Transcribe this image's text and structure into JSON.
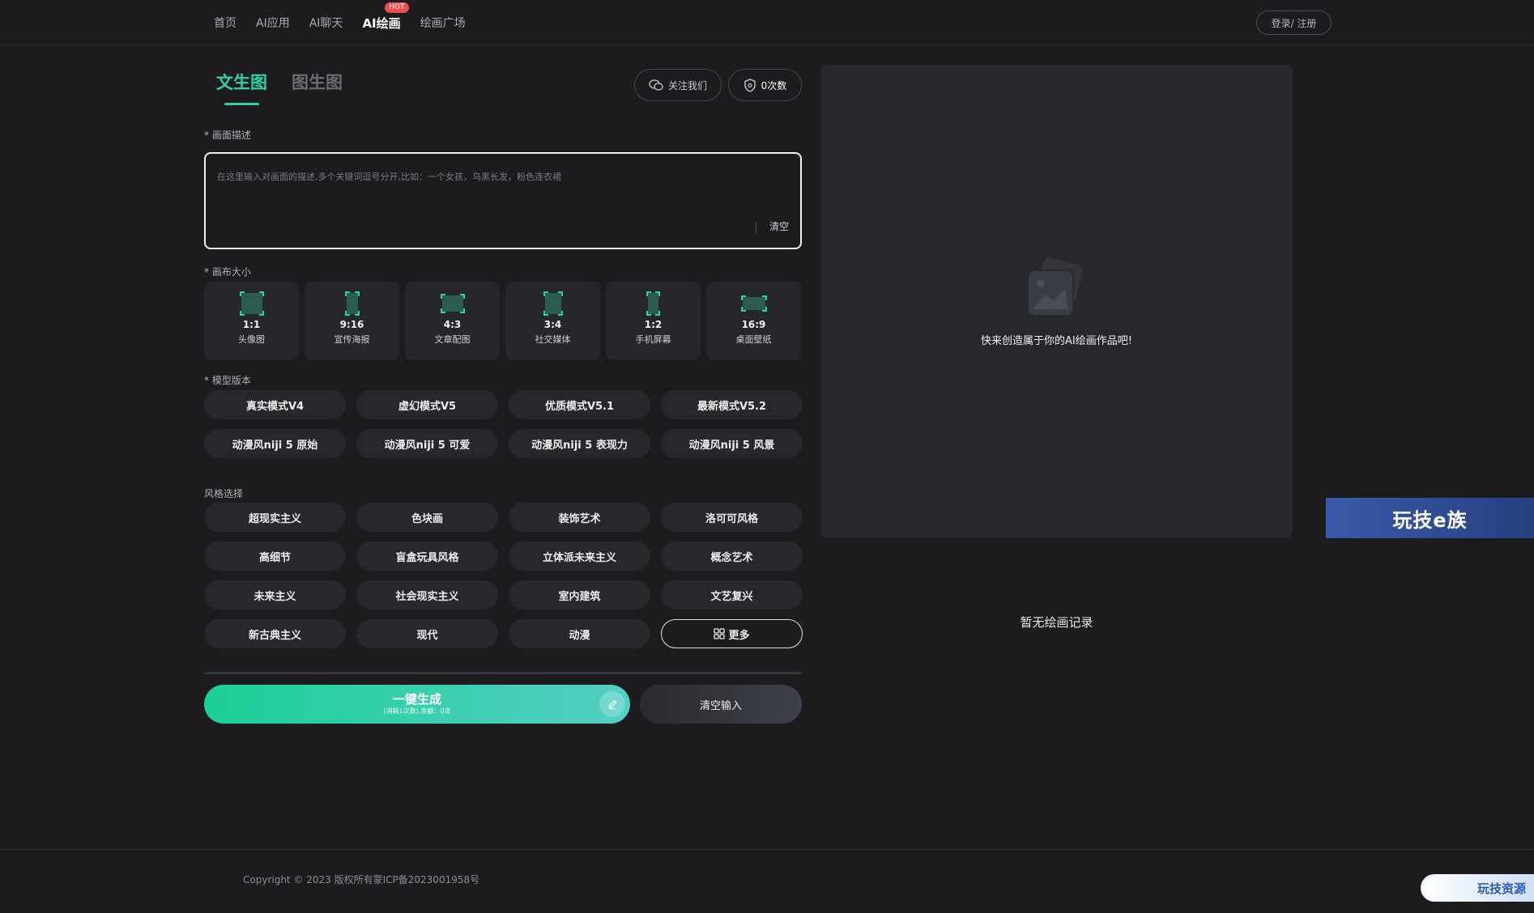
{
  "nav": {
    "items": [
      {
        "label": "首页"
      },
      {
        "label": "AI应用"
      },
      {
        "label": "AI聊天"
      },
      {
        "label": "AI绘画",
        "badge": "HOT"
      },
      {
        "label": "绘画广场"
      }
    ],
    "login": "登录/ 注册"
  },
  "tabs": [
    "文生图",
    "图生图"
  ],
  "actions": {
    "follow": "关注我们",
    "count": "0次数"
  },
  "prompt": {
    "label": "* 画面描述",
    "placeholder": "在这里输入对画面的描述,多个关键词逗号分开,比如：一个女孩，乌黑长发，粉色连衣裙",
    "clear": "清空"
  },
  "canvas": {
    "label": "* 画布大小",
    "options": [
      {
        "ratio": "1:1",
        "name": "头像图"
      },
      {
        "ratio": "9:16",
        "name": "宣传海报"
      },
      {
        "ratio": "4:3",
        "name": "文章配图"
      },
      {
        "ratio": "3:4",
        "name": "社交媒体"
      },
      {
        "ratio": "1:2",
        "name": "手机屏幕"
      },
      {
        "ratio": "16:9",
        "name": "桌面壁纸"
      }
    ]
  },
  "model": {
    "label": "* 模型版本",
    "options": [
      "真实模式V4",
      "虚幻模式V5",
      "优质模式V5.1",
      "最新模式V5.2",
      "动漫风niji 5 原始",
      "动漫风niji 5 可爱",
      "动漫风niji 5 表现力",
      "动漫风niji 5 风景"
    ]
  },
  "style": {
    "label": "风格选择",
    "options": [
      "超现实主义",
      "色块画",
      "装饰艺术",
      "洛可可风格",
      "高细节",
      "盲盒玩具风格",
      "立体派未来主义",
      "概念艺术",
      "未来主义",
      "社会现实主义",
      "室内建筑",
      "文艺复兴",
      "新古典主义",
      "现代",
      "动漫"
    ],
    "more": "更多"
  },
  "generate": {
    "title": "一键生成",
    "subtitle": "(消耗1次数),余额：0次"
  },
  "clear_input": "清空输入",
  "preview": {
    "text": "快来创造属于你的AI绘画作品吧!"
  },
  "no_record": "暂无绘画记录",
  "banner": "玩技e族",
  "footer": {
    "copyright": "Copyright © 2023 版权所有蒙ICP备2023001958号",
    "brand": "玩技资源"
  },
  "colors": {
    "accent": "#2ed3a2",
    "background": "#1c1c1f",
    "panel": "#27282d"
  }
}
